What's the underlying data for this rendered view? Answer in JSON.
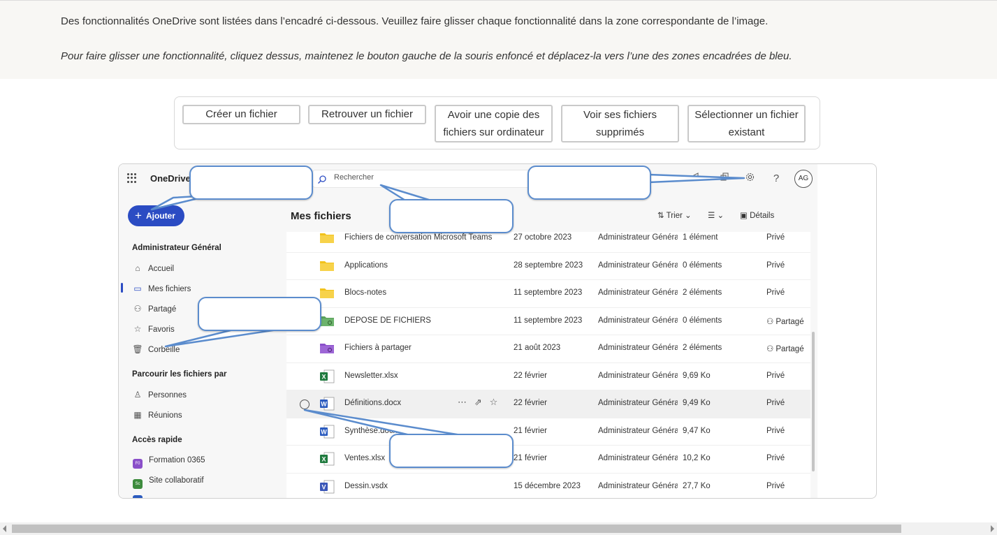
{
  "instructions": {
    "line1": "Des fonctionnalités OneDrive sont listées dans l’encadré ci-dessous. Veuillez faire glisser chaque fonctionnalité dans la zone correspondante de l’image.",
    "line2": "Pour faire glisser une fonctionnalité, cliquez dessus, maintenez le bouton gauche de la souris enfoncé et déplacez-la vers l’une des zones encadrées de bleu."
  },
  "tokens": [
    {
      "line1": "Créer un fichier",
      "line2": ""
    },
    {
      "line1": "Retrouver un fichier",
      "line2": ""
    },
    {
      "line1": "Avoir une copie des",
      "line2": "fichiers sur ordinateur"
    },
    {
      "line1": "Voir ses fichiers",
      "line2": "supprimés"
    },
    {
      "line1": "Sélectionner un fichier",
      "line2": "existant"
    }
  ],
  "onedrive": {
    "brand": "OneDrive",
    "search_placeholder": "Rechercher",
    "help": "?",
    "avatar": "AG",
    "add_button": "Ajouter",
    "user_section": "Administrateur Général",
    "nav": [
      "Accueil",
      "Mes fichiers",
      "Partagé",
      "Favoris",
      "Corbeille"
    ],
    "browse_section": "Parcourir les fichiers par",
    "browse": [
      "Personnes",
      "Réunions"
    ],
    "quick_section": "Accès rapide",
    "quick": [
      {
        "label": "Formation 0365",
        "badge": "F0",
        "color": "#8a4fc9"
      },
      {
        "label": "Site collaboratif",
        "badge": "Sc",
        "color": "#3d8b3d"
      }
    ],
    "title": "Mes fichiers",
    "sort": "Trier",
    "details": "Détails",
    "files": [
      {
        "name": "Fichiers de conversation Microsoft Teams",
        "date": "27 octobre 2023",
        "owner": "Administrateur Général",
        "size": "1 élément",
        "sharing": "Privé",
        "icon": "folder"
      },
      {
        "name": "Applications",
        "date": "28 septembre 2023",
        "owner": "Administrateur Général",
        "size": "0 éléments",
        "sharing": "Privé",
        "icon": "folder"
      },
      {
        "name": "Blocs-notes",
        "date": "11 septembre 2023",
        "owner": "Administrateur Général",
        "size": "2 éléments",
        "sharing": "Privé",
        "icon": "folder"
      },
      {
        "name": "DEPOSE DE FICHIERS",
        "date": "11 septembre 2023",
        "owner": "Administrateur Général",
        "size": "0 éléments",
        "sharing": "Partagé",
        "icon": "folder-green"
      },
      {
        "name": "Fichiers à partager",
        "date": "21 août 2023",
        "owner": "Administrateur Général",
        "size": "2 éléments",
        "sharing": "Partagé",
        "icon": "folder-purple"
      },
      {
        "name": "Newsletter.xlsx",
        "date": "22 février",
        "owner": "Administrateur Général",
        "size": "9,69 Ko",
        "sharing": "Privé",
        "icon": "excel"
      },
      {
        "name": "Définitions.docx",
        "date": "22 février",
        "owner": "Administrateur Général",
        "size": "9,49 Ko",
        "sharing": "Privé",
        "icon": "word"
      },
      {
        "name": "Synthèse.docx",
        "date": "21 février",
        "owner": "Administrateur Général",
        "size": "9,47 Ko",
        "sharing": "Privé",
        "icon": "word"
      },
      {
        "name": "Ventes.xlsx",
        "date": "21 février",
        "owner": "Administrateur Général",
        "size": "10,2 Ko",
        "sharing": "Privé",
        "icon": "excel"
      },
      {
        "name": "Dessin.vsdx",
        "date": "15 décembre 2023",
        "owner": "Administrateur Général",
        "size": "27,7 Ko",
        "sharing": "Privé",
        "icon": "visio"
      }
    ]
  },
  "colors": {
    "callout_border": "#5b8ccd",
    "add_button": "#2b4cc3",
    "folder": "#f2c21b",
    "excel": "#1f7a3e",
    "word": "#2b5bbf",
    "visio": "#3a56b8"
  }
}
